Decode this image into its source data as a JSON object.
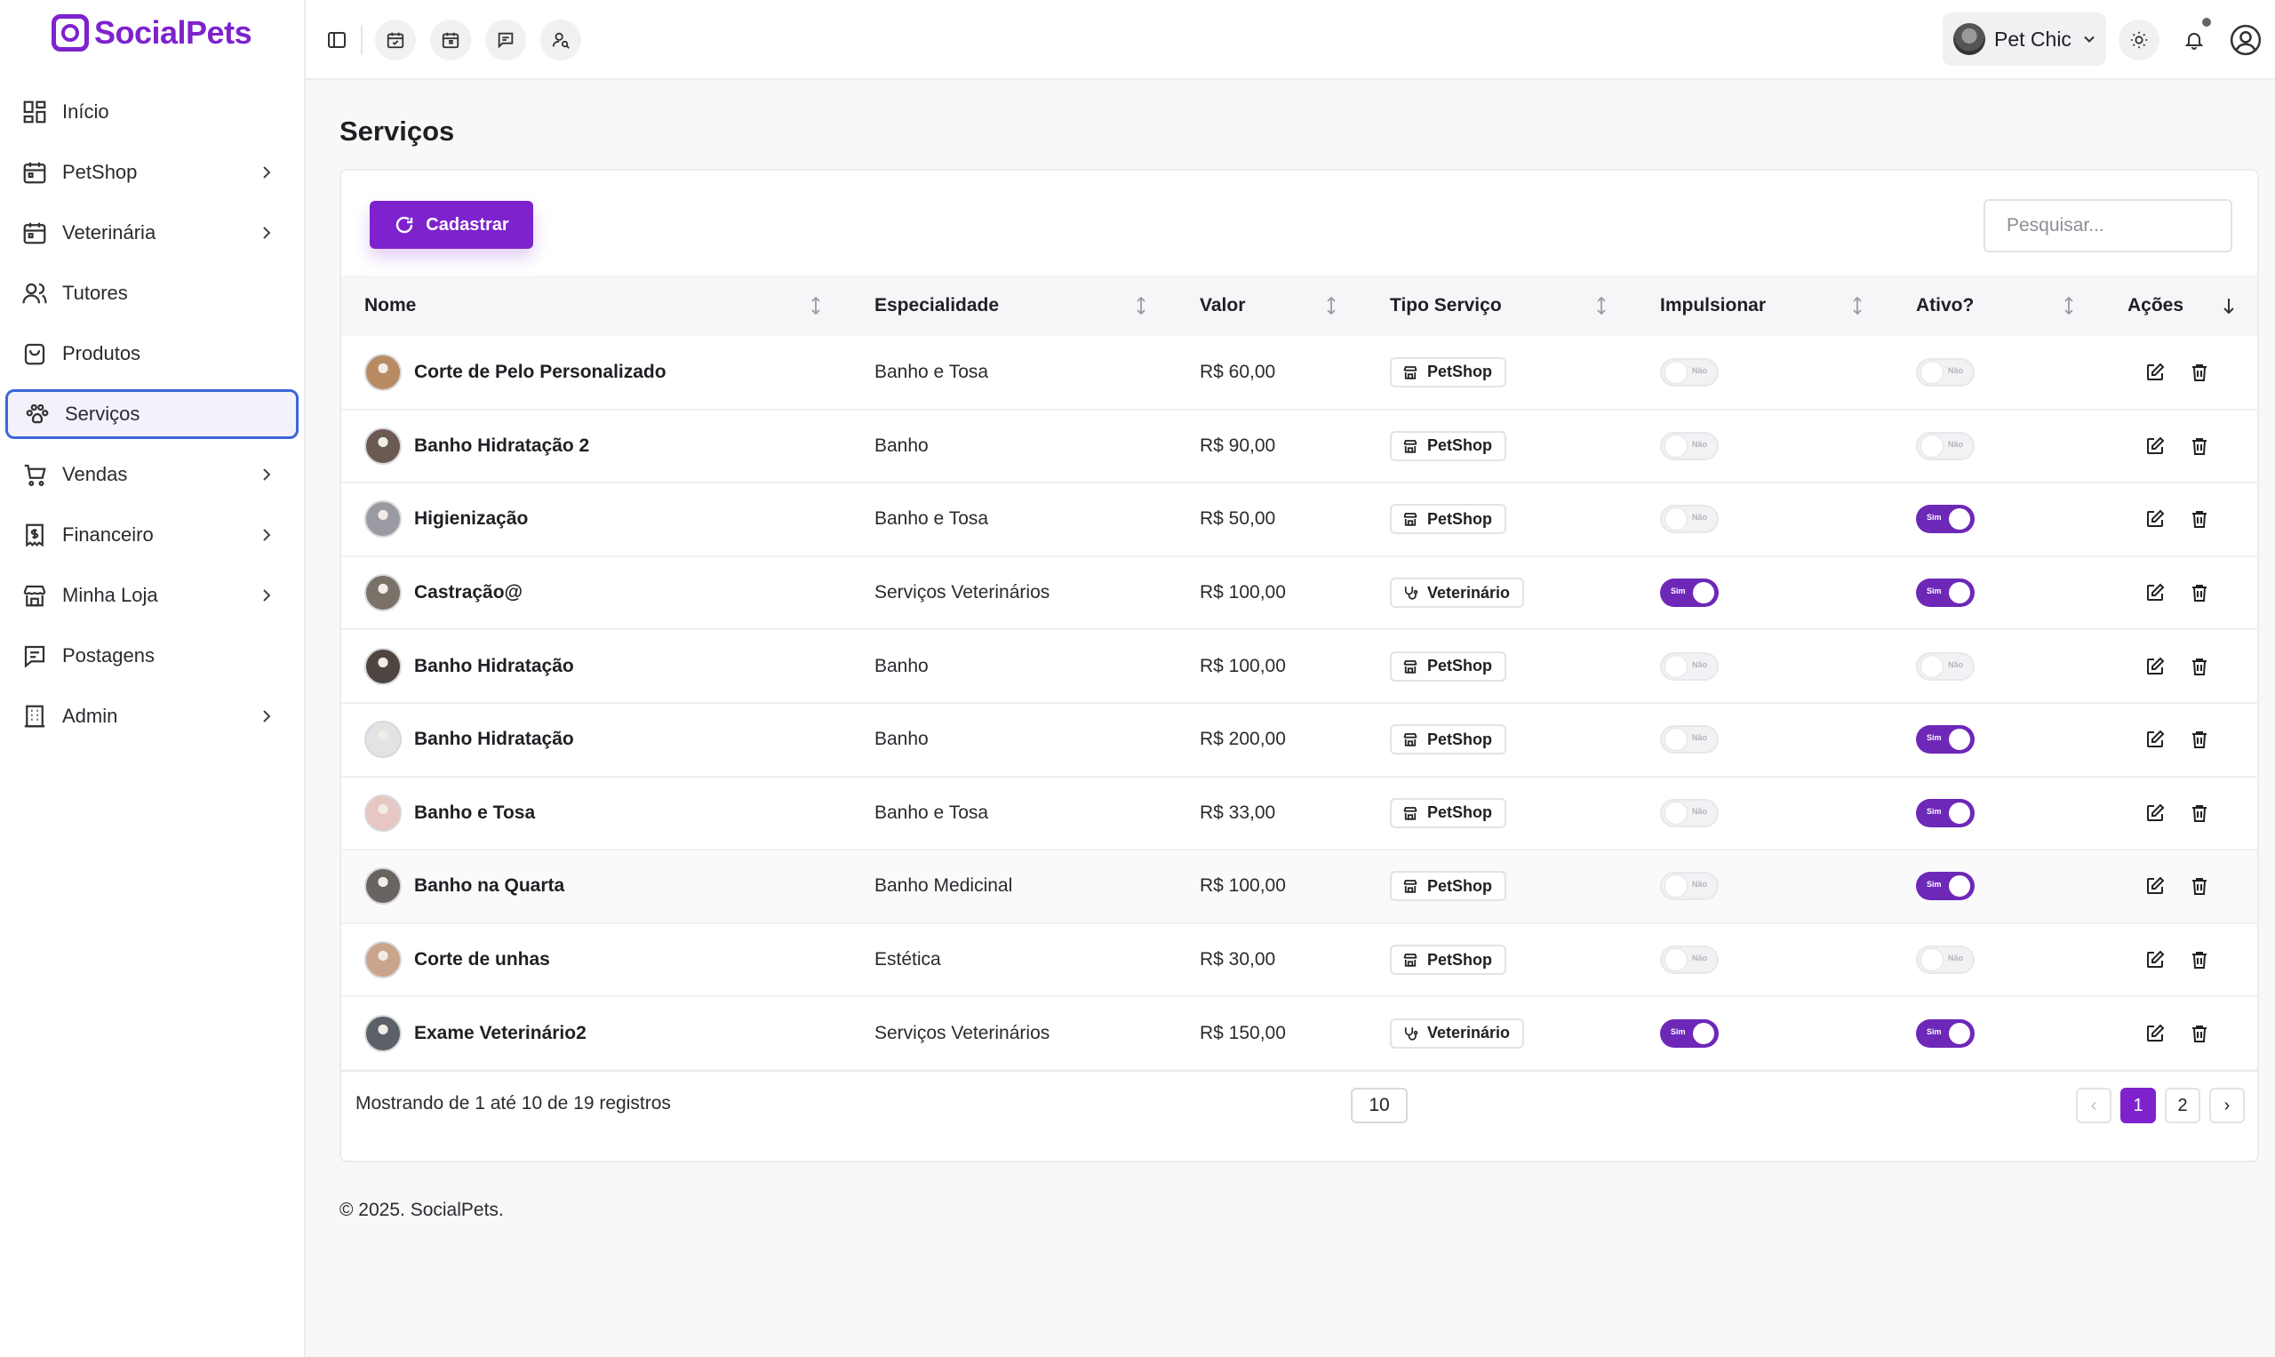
{
  "app": {
    "logo_text": "SocialPets"
  },
  "sidebar": {
    "items": [
      {
        "label": "Início",
        "icon": "dashboard-icon",
        "has_chevron": false
      },
      {
        "label": "PetShop",
        "icon": "calendar-icon",
        "has_chevron": true
      },
      {
        "label": "Veterinária",
        "icon": "calendar-icon",
        "has_chevron": true
      },
      {
        "label": "Tutores",
        "icon": "users-icon",
        "has_chevron": false
      },
      {
        "label": "Produtos",
        "icon": "bag-icon",
        "has_chevron": false
      },
      {
        "label": "Serviços",
        "icon": "paw-icon",
        "has_chevron": false,
        "active": true
      },
      {
        "label": "Vendas",
        "icon": "cart-icon",
        "has_chevron": true
      },
      {
        "label": "Financeiro",
        "icon": "receipt-icon",
        "has_chevron": true
      },
      {
        "label": "Minha Loja",
        "icon": "store-icon",
        "has_chevron": true
      },
      {
        "label": "Postagens",
        "icon": "message-icon",
        "has_chevron": false
      },
      {
        "label": "Admin",
        "icon": "building-icon",
        "has_chevron": true
      }
    ]
  },
  "topbar": {
    "store_name": "Pet Chic",
    "icons": [
      "sidebar-toggle-icon",
      "calendar-check-icon",
      "calendar-icon",
      "chat-icon",
      "user-search-icon",
      "sun-icon",
      "bell-icon",
      "user-circle-icon"
    ]
  },
  "main": {
    "title": "Serviços",
    "add_button": "Cadastrar",
    "search_placeholder": "Pesquisar..."
  },
  "table": {
    "headers": [
      "Nome",
      "Especialidade",
      "Valor",
      "Tipo Serviço",
      "Impulsionar",
      "Ativo?",
      "Ações"
    ],
    "toggle_on_label": "Sim",
    "toggle_off_label": "Não",
    "rows": [
      {
        "name": "Corte de Pelo Personalizado",
        "specialty": "Banho e Tosa",
        "value": "R$ 60,00",
        "type": "PetShop",
        "type_icon": "store-icon",
        "boost": false,
        "active": false,
        "avatar_color": "#b98b63"
      },
      {
        "name": "Banho Hidratação 2",
        "specialty": "Banho",
        "value": "R$ 90,00",
        "type": "PetShop",
        "type_icon": "store-icon",
        "boost": false,
        "active": false,
        "avatar_color": "#6b5a52"
      },
      {
        "name": "Higienização",
        "specialty": "Banho e Tosa",
        "value": "R$ 50,00",
        "type": "PetShop",
        "type_icon": "store-icon",
        "boost": false,
        "active": true,
        "avatar_color": "#9a9aa2"
      },
      {
        "name": "Castração@",
        "specialty": "Serviços Veterinários",
        "value": "R$ 100,00",
        "type": "Veterinário",
        "type_icon": "stethoscope-icon",
        "boost": true,
        "active": true,
        "avatar_color": "#7a7168"
      },
      {
        "name": "Banho Hidratação",
        "specialty": "Banho",
        "value": "R$ 100,00",
        "type": "PetShop",
        "type_icon": "store-icon",
        "boost": false,
        "active": false,
        "avatar_color": "#4f4540"
      },
      {
        "name": "Banho Hidratação",
        "specialty": "Banho",
        "value": "R$ 200,00",
        "type": "PetShop",
        "type_icon": "store-icon",
        "boost": false,
        "active": true,
        "avatar_color": "#e3e3e6"
      },
      {
        "name": "Banho e Tosa",
        "specialty": "Banho e Tosa",
        "value": "R$ 33,00",
        "type": "PetShop",
        "type_icon": "store-icon",
        "boost": false,
        "active": true,
        "avatar_color": "#e7c7c3"
      },
      {
        "name": "Banho na Quarta",
        "specialty": "Banho Medicinal",
        "value": "R$ 100,00",
        "type": "PetShop",
        "type_icon": "store-icon",
        "boost": false,
        "active": true,
        "avatar_color": "#6a6460",
        "highlight": true
      },
      {
        "name": "Corte de unhas",
        "specialty": "Estética",
        "value": "R$ 30,00",
        "type": "PetShop",
        "type_icon": "store-icon",
        "boost": false,
        "active": false,
        "avatar_color": "#c9a38a"
      },
      {
        "name": "Exame Veterinário2",
        "specialty": "Serviços Veterinários",
        "value": "R$ 150,00",
        "type": "Veterinário",
        "type_icon": "stethoscope-icon",
        "boost": true,
        "active": true,
        "avatar_color": "#5c6068"
      }
    ]
  },
  "pagination": {
    "showing_text": "Mostrando de 1 até 10 de 19 registros",
    "per_page": "10",
    "prev": "‹",
    "next": "›",
    "pages": [
      "1",
      "2"
    ],
    "current_page": "1"
  },
  "footer": {
    "copyright": "© 2025. SocialPets."
  },
  "colors": {
    "accent": "#7e22ce",
    "active_border": "#3b67d6",
    "toggle_on": "#6d28b8"
  }
}
